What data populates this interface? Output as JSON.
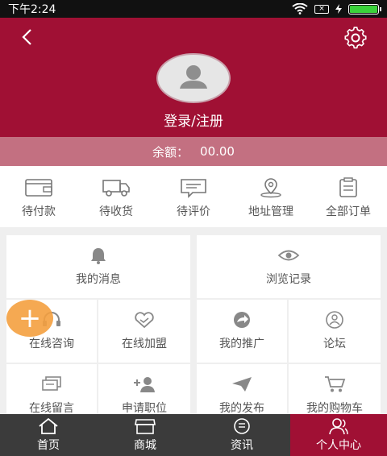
{
  "status_bar": {
    "time": "下午2:24",
    "sim_label": "×"
  },
  "header": {
    "login_label": "登录/注册"
  },
  "balance": {
    "label": "余额：",
    "value": "00.00"
  },
  "orders": [
    {
      "label": "待付款",
      "icon": "wallet-icon"
    },
    {
      "label": "待收货",
      "icon": "truck-icon"
    },
    {
      "label": "待评价",
      "icon": "comment-icon"
    },
    {
      "label": "地址管理",
      "icon": "location-icon"
    },
    {
      "label": "全部订单",
      "icon": "clipboard-icon"
    }
  ],
  "features": {
    "messages": "我的消息",
    "history": "浏览记录",
    "consult": "在线咨询",
    "join": "在线加盟",
    "promote": "我的推广",
    "forum": "论坛",
    "leave_msg": "在线留言",
    "apply_job": "申请职位",
    "my_posts": "我的发布",
    "cart": "我的购物车"
  },
  "fab": {
    "label": "+"
  },
  "tabs": [
    {
      "label": "首页",
      "icon": "home-icon"
    },
    {
      "label": "商城",
      "icon": "shop-icon"
    },
    {
      "label": "资讯",
      "icon": "news-icon"
    },
    {
      "label": "个人中心",
      "icon": "user-icon"
    }
  ],
  "colors": {
    "brand": "#a01034",
    "balance_bar": "#c37081",
    "fab": "#f4a040",
    "tabbar": "#3b3b3b"
  }
}
